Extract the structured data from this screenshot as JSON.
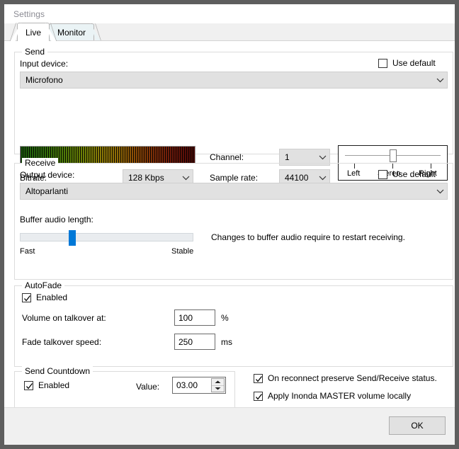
{
  "window": {
    "title": "Settings"
  },
  "tabs": [
    {
      "label": "Live",
      "selected": true
    },
    {
      "label": "Monitor",
      "selected": false
    }
  ],
  "send": {
    "group_title": "Send",
    "input_device_label": "Input device:",
    "use_default_label": "Use default",
    "use_default_checked": false,
    "input_device_value": "Microfono",
    "bitrate_label": "Bitrate:",
    "bitrate_value": "128 Kbps",
    "channel_label": "Channel:",
    "channel_value": "1",
    "sample_rate_label": "Sample rate:",
    "sample_rate_value": "44100",
    "balance": {
      "left_label": "Left",
      "center_label": "Stereo",
      "right_label": "Right",
      "position_percent": 50
    },
    "vu_level_percent": 100
  },
  "receive": {
    "group_title": "Receive",
    "output_device_label": "Output device:",
    "use_default_label": "Use default",
    "use_default_checked": false,
    "output_device_value": "Altoparlanti",
    "buffer_label": "Buffer audio length:",
    "buffer_value_percent": 28,
    "buffer_min_label": "Fast",
    "buffer_max_label": "Stable",
    "buffer_note": "Changes to buffer audio require to restart receiving."
  },
  "autofade": {
    "group_title": "AutoFade",
    "enabled_label": "Enabled",
    "enabled_checked": true,
    "volume_label": "Volume on talkover at:",
    "volume_value": "100",
    "volume_unit": "%",
    "speed_label": "Fade talkover speed:",
    "speed_value": "250",
    "speed_unit": "ms"
  },
  "send_countdown": {
    "group_title": "Send Countdown",
    "enabled_label": "Enabled",
    "enabled_checked": true,
    "value_label": "Value:",
    "value": "03.00"
  },
  "options": {
    "reconnect_label": "On reconnect preserve Send/Receive status.",
    "reconnect_checked": true,
    "master_volume_label": "Apply Inonda MASTER volume locally",
    "master_volume_checked": true
  },
  "footer": {
    "ok_label": "OK"
  },
  "colors": {
    "accent": "#0078d7",
    "window_border": "#5e5e5e",
    "tab_selected_bg": "#ffffff",
    "tab_bg": "#eaf3f5",
    "footer_bg": "#f0f0f0",
    "combo_bg": "#e1e1e1"
  }
}
